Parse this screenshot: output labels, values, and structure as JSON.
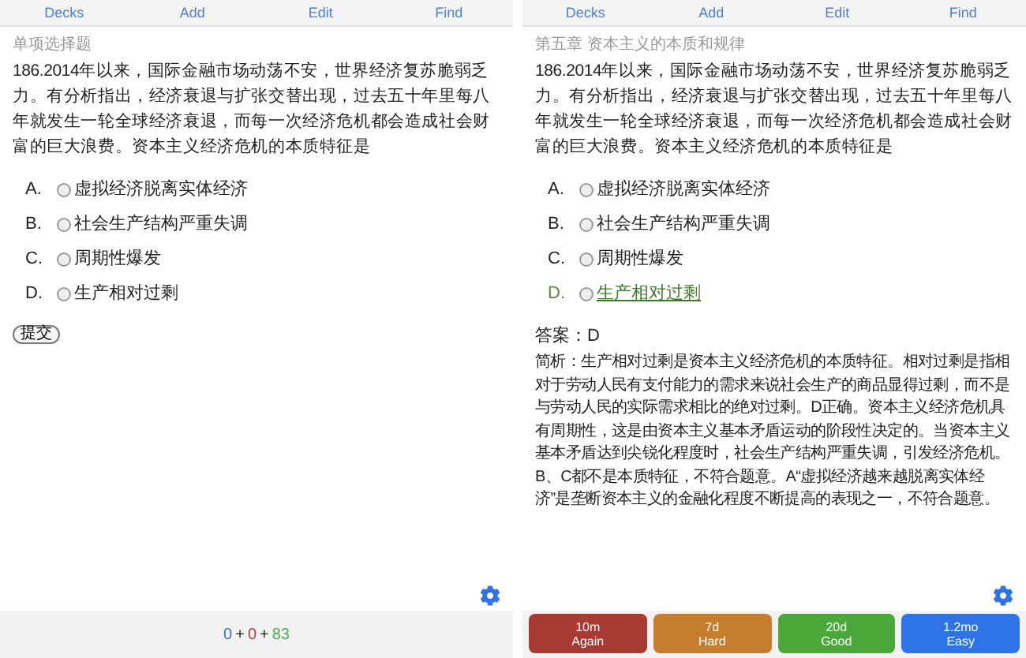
{
  "panels": [
    {
      "toolbar": [
        {
          "label": "Decks"
        },
        {
          "label": "Add"
        },
        {
          "label": "Edit"
        },
        {
          "label": "Find"
        }
      ],
      "category": "单项选择题",
      "question": "186.2014年以来，国际金融市场动荡不安，世界经济复苏脆弱乏力。有分析指出，经济衰退与扩张交替出现，过去五十年里每八年就发生一轮全球经济衰退，而每一次经济危机都会造成社会财富的巨大浪费。资本主义经济危机的本质特征是",
      "options": [
        {
          "letter": "A.",
          "text": "虚拟经济脱离实体经济",
          "correct": false,
          "selected": false
        },
        {
          "letter": "B.",
          "text": "社会生产结构严重失调",
          "correct": false,
          "selected": false
        },
        {
          "letter": "C.",
          "text": "周期性爆发",
          "correct": false,
          "selected": false
        },
        {
          "letter": "D.",
          "text": "生产相对过剩",
          "correct": false,
          "selected": false
        }
      ],
      "submit_button": "提交",
      "counts": [
        {
          "text": "0",
          "color": "#3b6fd6"
        },
        {
          "text": "+",
          "color": "#222222"
        },
        {
          "text": "0",
          "color": "#c0392b"
        },
        {
          "text": "+",
          "color": "#222222"
        },
        {
          "text": "83",
          "color": "#4caf50"
        }
      ]
    },
    {
      "toolbar": [
        {
          "label": "Decks"
        },
        {
          "label": "Add"
        },
        {
          "label": "Edit"
        },
        {
          "label": "Find"
        }
      ],
      "category": "第五章 资本主义的本质和规律",
      "question": "186.2014年以来，国际金融市场动荡不安，世界经济复苏脆弱乏力。有分析指出，经济衰退与扩张交替出现，过去五十年里每八年就发生一轮全球经济衰退，而每一次经济危机都会造成社会财富的巨大浪费。资本主义经济危机的本质特征是",
      "options": [
        {
          "letter": "A.",
          "text": "虚拟经济脱离实体经济",
          "correct": false,
          "selected": false
        },
        {
          "letter": "B.",
          "text": "社会生产结构严重失调",
          "correct": false,
          "selected": false
        },
        {
          "letter": "C.",
          "text": "周期性爆发",
          "correct": false,
          "selected": false
        },
        {
          "letter": "D.",
          "text": "生产相对过剩",
          "correct": true,
          "selected": false
        }
      ],
      "answer": "答案：D",
      "explanation": "简析：生产相对过剩是资本主义经济危机的本质特征。相对过剩是指相对于劳动人民有支付能力的需求来说社会生产的商品显得过剩，而不是与劳动人民的实际需求相比的绝对过剩。D正确。资本主义经济危机具有周期性，这是由资本主义基本矛盾运动的阶段性决定的。当资本主义基本矛盾达到尖锐化程度时，社会生产结构严重失调，引发经济危机。B、C都不是本质特征，不符合题意。A“虚拟经济越来越脱离实体经济”是垄断资本主义的金融化程度不断提高的表现之一，不符合题意。",
      "answer_buttons": [
        {
          "interval": "10m",
          "label": "Again",
          "color": "#a83a34"
        },
        {
          "interval": "7d",
          "label": "Hard",
          "color": "#c77d2e"
        },
        {
          "interval": "20d",
          "label": "Good",
          "color": "#4aa83a"
        },
        {
          "interval": "1.2mo",
          "label": "Easy",
          "color": "#2f74e6"
        }
      ]
    }
  ]
}
